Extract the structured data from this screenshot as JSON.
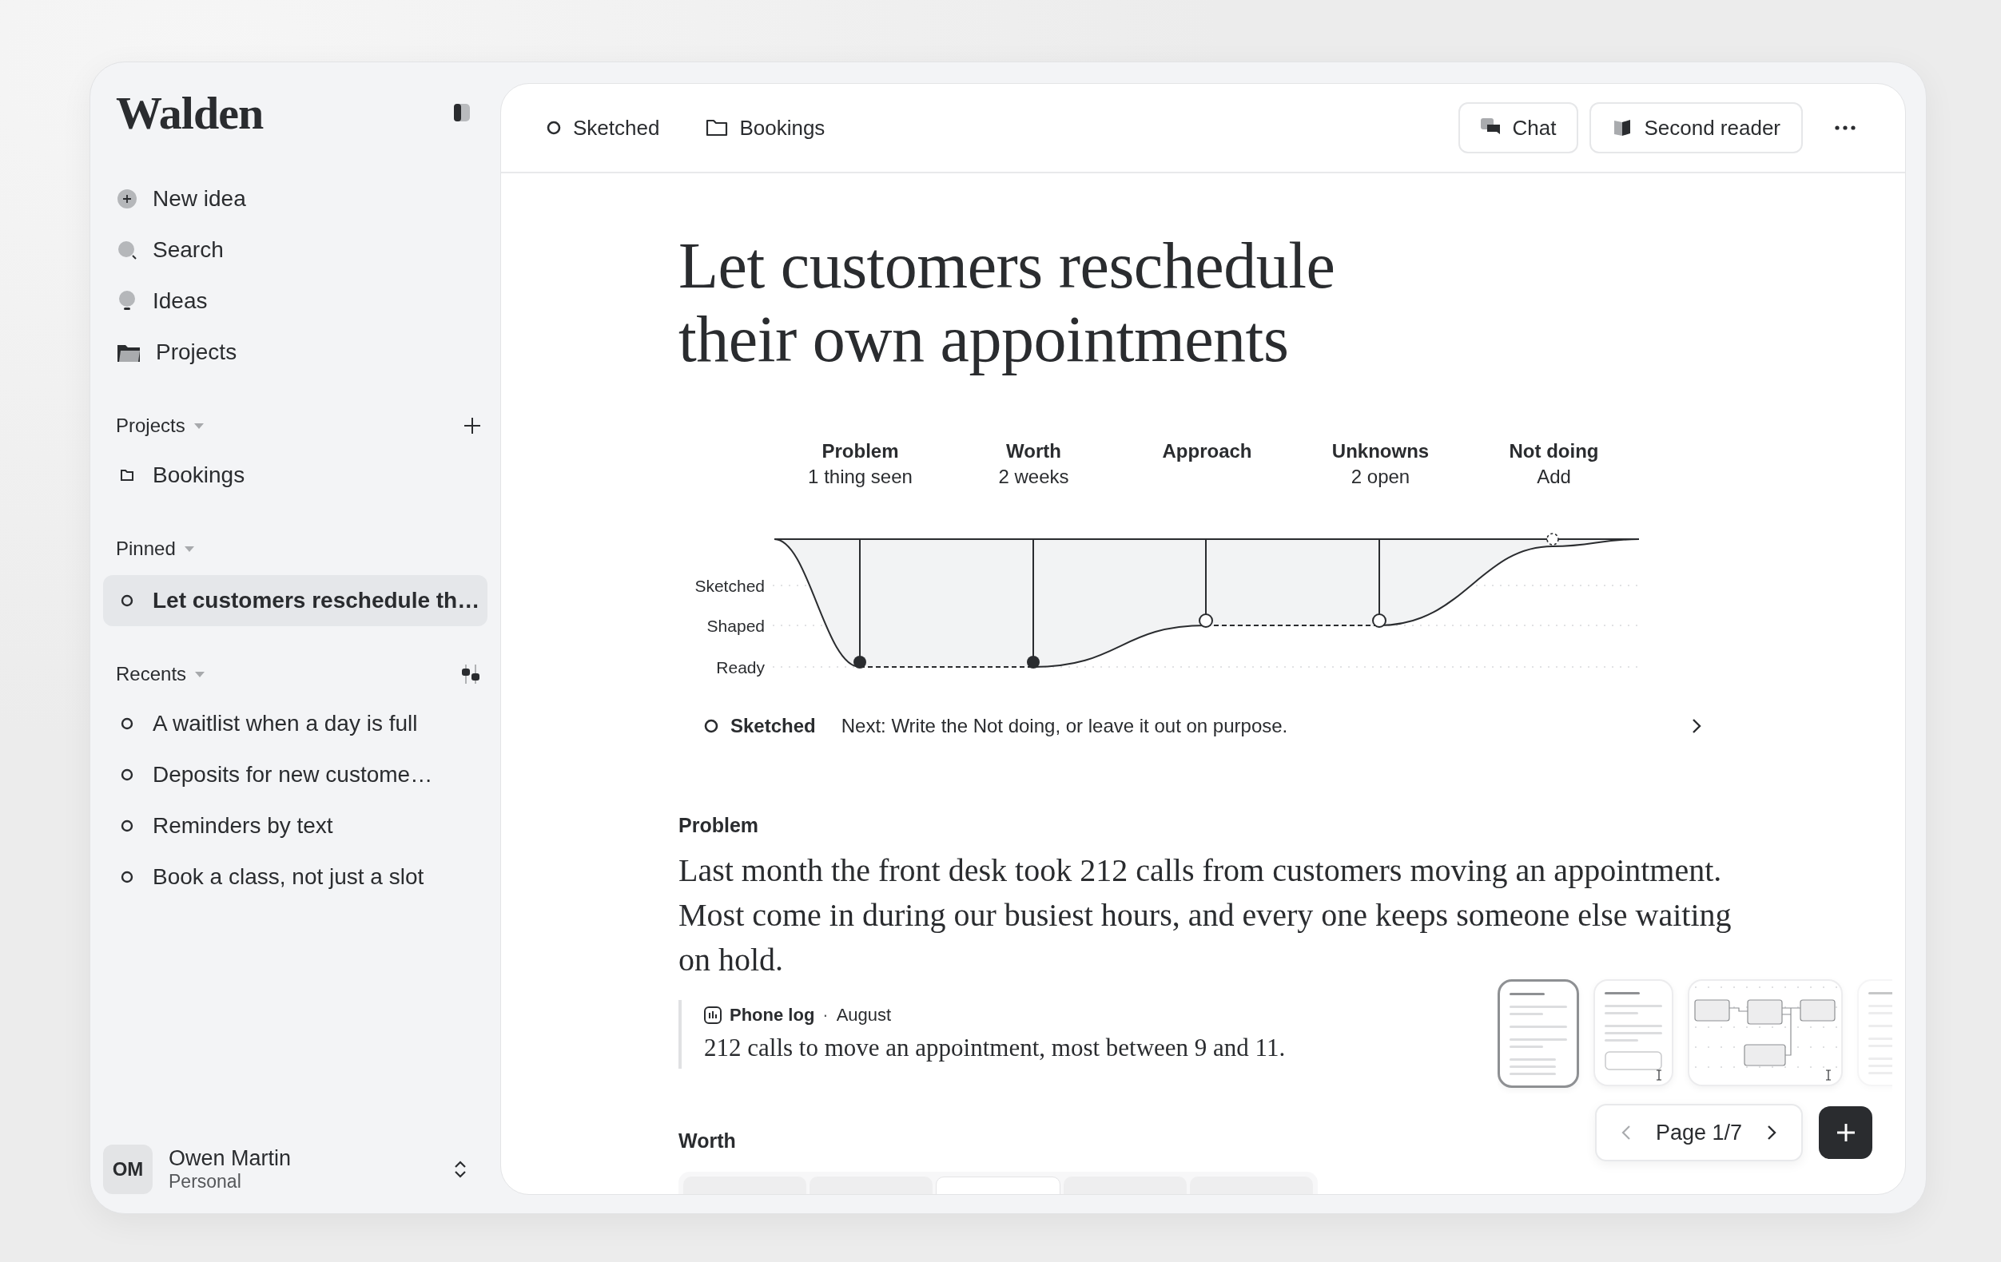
{
  "sidebar": {
    "logo": "Walden",
    "nav": [
      {
        "label": "New idea",
        "kind": "new"
      },
      {
        "label": "Search",
        "kind": "search"
      },
      {
        "label": "Ideas",
        "kind": "ideas"
      },
      {
        "label": "Projects",
        "kind": "projects"
      }
    ],
    "sections": [
      {
        "title": "Projects",
        "kind": "add",
        "items": [
          {
            "label": "Bookings",
            "kind": "project"
          }
        ]
      },
      {
        "title": "Pinned",
        "items": [
          {
            "label": "Let customers reschedule th…",
            "kind": "idea",
            "selected": true
          }
        ]
      },
      {
        "title": "Recents",
        "kind": "filter",
        "items": [
          {
            "label": "A waitlist when a day is full",
            "kind": "idea",
            "selected": false
          },
          {
            "label": "Deposits for new custome…",
            "kind": "idea",
            "selected": false
          },
          {
            "label": "Reminders by text",
            "kind": "idea",
            "selected": false
          },
          {
            "label": "Book a class, not just a slot",
            "kind": "idea",
            "selected": false
          }
        ]
      }
    ],
    "user": {
      "initials": "OM",
      "name": "Owen Martin",
      "workspace": "Personal"
    }
  },
  "topbar": {
    "status": "Sketched",
    "project": "Bookings",
    "buttons": [
      {
        "label": "Chat",
        "kind": "chat"
      },
      {
        "label": "Second reader",
        "kind": "reader"
      }
    ]
  },
  "document": {
    "title": "Let customers reschedule their own appointments",
    "stages": [
      {
        "name": "Problem",
        "detail": "1 thing seen",
        "kind": "ready"
      },
      {
        "name": "Worth",
        "detail": "2 weeks",
        "kind": "ready"
      },
      {
        "name": "Approach",
        "kind": "shaped"
      },
      {
        "name": "Unknowns",
        "detail": "2 open",
        "kind": "shaped"
      },
      {
        "name": "Not doing",
        "detail": "Add",
        "kind": "pending"
      }
    ],
    "levels": [
      "Sketched",
      "Shaped",
      "Ready"
    ],
    "status": {
      "label": "Sketched",
      "next": "Next: Write the Not doing, or leave it out on purpose."
    },
    "problem": {
      "heading": "Problem",
      "body": "Last month the front desk took 212 calls from customers moving an appointment. Most come in during our busiest hours, and every one keeps someone else waiting on hold.",
      "evidence": {
        "source": "Phone log",
        "separator": "·",
        "date": "August",
        "text": "212 calls to move an appointment, most between 9 and 11."
      }
    },
    "worth": {
      "heading": "Worth",
      "segments": [
        {
          "selected": false
        },
        {
          "selected": false
        },
        {
          "selected": true
        },
        {
          "selected": false
        },
        {
          "selected": false
        }
      ]
    }
  },
  "pages": {
    "thumbnails": [
      {
        "kind": "text",
        "selected": true
      },
      {
        "kind": "form",
        "selected": false
      },
      {
        "kind": "diagram",
        "selected": false
      },
      {
        "kind": "text",
        "selected": false
      }
    ],
    "label": "Page 1/7"
  }
}
